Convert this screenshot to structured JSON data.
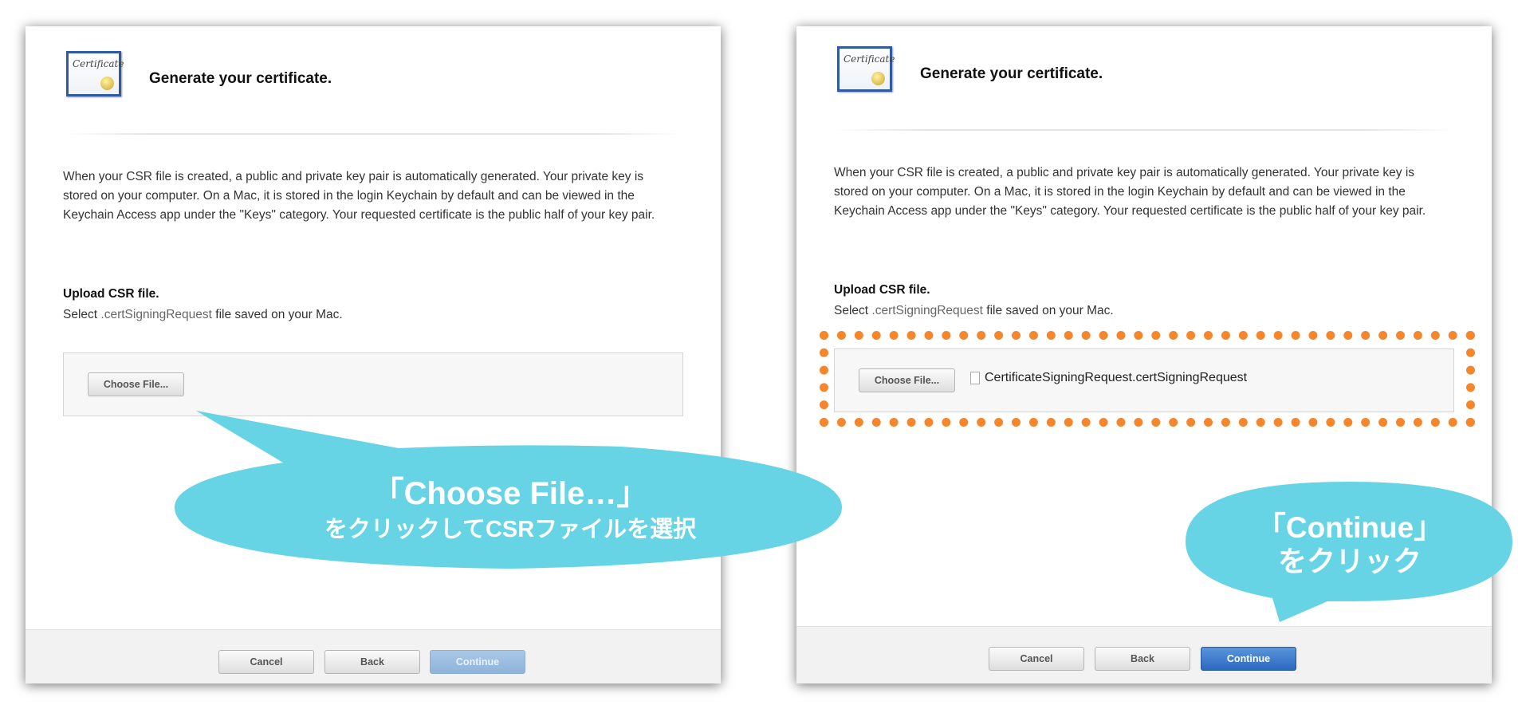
{
  "colors": {
    "bubble": "#66d4e5",
    "highlight": "#f5862b",
    "continue_enabled": "#2c68bf",
    "continue_disabled": "#9bbde1"
  },
  "icon_label": "Certificate",
  "left": {
    "title": "Generate your certificate.",
    "paragraph": "When your CSR file is created, a public and private key pair is automatically generated. Your private key is stored on your computer. On a Mac, it is stored in the login Keychain by default and can be viewed in the Keychain Access app under the \"Keys\" category. Your requested certificate is the public half of your key pair.",
    "upload_heading": "Upload CSR file.",
    "upload_pre": "Select ",
    "upload_ext": ".certSigningRequest",
    "upload_post": " file saved on your Mac.",
    "choose_file": "Choose File...",
    "cancel": "Cancel",
    "back": "Back",
    "continue": "Continue"
  },
  "right": {
    "title": "Generate your certificate.",
    "paragraph": "When your CSR file is created, a public and private key pair is automatically generated. Your private key is stored on your computer. On a Mac, it is stored in the login Keychain by default and can be viewed in the Keychain Access app under the \"Keys\" category. Your requested certificate is the public half of your key pair.",
    "upload_heading": "Upload CSR file.",
    "upload_pre": "Select ",
    "upload_ext": ".certSigningRequest",
    "upload_post": " file saved on your Mac.",
    "choose_file": "Choose File...",
    "file_name": "CertificateSigningRequest.certSigningRequest",
    "cancel": "Cancel",
    "back": "Back",
    "continue": "Continue"
  },
  "callouts": {
    "left_line1": "「Choose File…」",
    "left_line2": "をクリックしてCSRファイルを選択",
    "right_line1": "「Continue」",
    "right_line2": "をクリック"
  }
}
